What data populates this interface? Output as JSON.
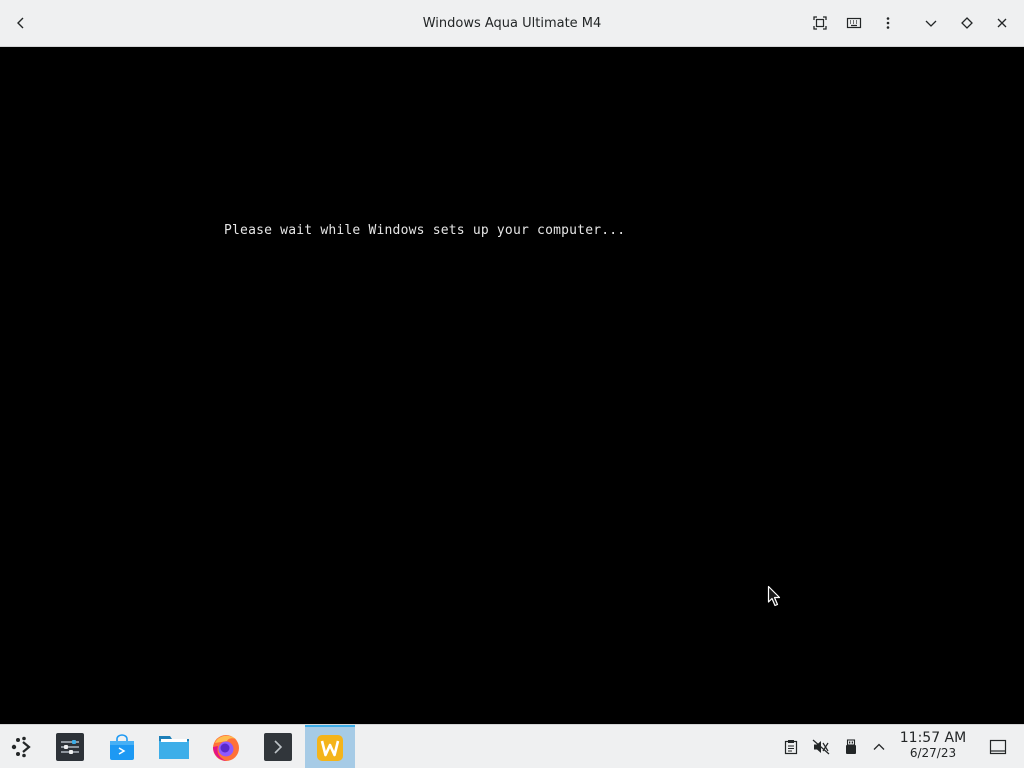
{
  "window": {
    "title": "Windows Aqua Ultimate M4"
  },
  "vm": {
    "message": "Please wait while Windows sets up your computer..."
  },
  "titlebar_buttons": [
    "back-icon",
    "fullscreen-icon",
    "keyboard-icon",
    "menu-icon",
    "minimize-icon",
    "maximize-icon",
    "close-icon"
  ],
  "taskbar": {
    "apps": [
      {
        "name": "application-launcher",
        "icon": "launcher-icon"
      },
      {
        "name": "system-settings",
        "icon": "settings-icon"
      },
      {
        "name": "discover-store",
        "icon": "store-icon"
      },
      {
        "name": "file-manager",
        "icon": "folder-icon"
      },
      {
        "name": "firefox",
        "icon": "firefox-icon"
      },
      {
        "name": "terminal",
        "icon": "terminal-icon"
      },
      {
        "name": "virtual-machine",
        "icon": "w-icon",
        "active": true
      }
    ],
    "tray": [
      "clipboard-icon",
      "volume-muted-icon",
      "usb-icon",
      "chevron-up-icon"
    ],
    "clock": {
      "time": "11:57 AM",
      "date": "6/27/23"
    }
  },
  "colors": {
    "titlebar_bg": "#eff0f1",
    "screen_bg": "#000000",
    "active_task_bg": "#a6cbe6",
    "accent": "#3daee9"
  }
}
